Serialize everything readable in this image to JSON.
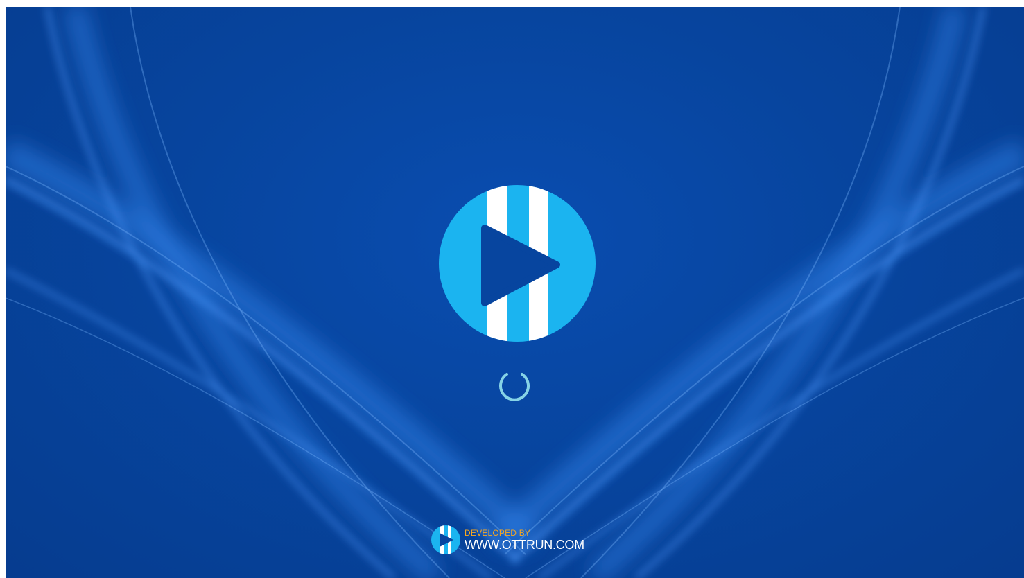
{
  "splash": {
    "logo_icon": "play-logo-icon",
    "loading_indicator": "spinner-icon"
  },
  "credit": {
    "developed_by": "DEVELOPED BY",
    "website": "WWW.OTTRUN.COM",
    "icon": "ottrun-logo-icon"
  },
  "colors": {
    "background": "#07459f",
    "logo_circle": "#1bb4f0",
    "logo_stripes": "#ffffff",
    "play_triangle": "#07459f",
    "spinner": "#86d3e6",
    "developed_by": "#f5a623",
    "website": "#ffffff"
  }
}
